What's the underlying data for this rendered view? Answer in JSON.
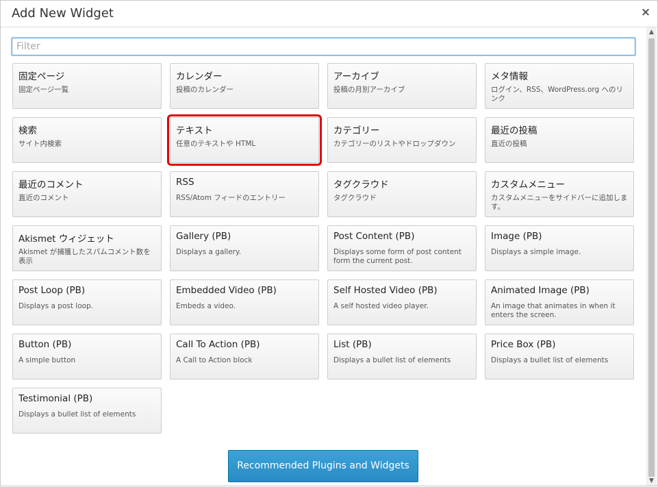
{
  "dialog": {
    "title": "Add New Widget",
    "close_symbol": "×"
  },
  "filter": {
    "placeholder": "Filter",
    "value": ""
  },
  "widgets": [
    {
      "title": "固定ページ",
      "desc": "固定ページ一覧"
    },
    {
      "title": "カレンダー",
      "desc": "投稿のカレンダー"
    },
    {
      "title": "アーカイブ",
      "desc": "投稿の月別アーカイブ"
    },
    {
      "title": "メタ情報",
      "desc": "ログイン、RSS、WordPress.org へのリンク"
    },
    {
      "title": "検索",
      "desc": "サイト内検索"
    },
    {
      "title": "テキスト",
      "desc": "任意のテキストや HTML",
      "highlighted": true
    },
    {
      "title": "カテゴリー",
      "desc": "カテゴリーのリストやドロップダウン"
    },
    {
      "title": "最近の投稿",
      "desc": "直近の投稿"
    },
    {
      "title": "最近のコメント",
      "desc": "直近のコメント"
    },
    {
      "title": "RSS",
      "desc": "RSS/Atom フィードのエントリー"
    },
    {
      "title": "タグクラウド",
      "desc": "タグクラウド"
    },
    {
      "title": "カスタムメニュー",
      "desc": "カスタムメニューをサイドバーに追加します。"
    },
    {
      "title": "Akismet ウィジェット",
      "desc": "Akismet が捕獲したスパムコメント数を表示"
    },
    {
      "title": "Gallery (PB)",
      "desc": "Displays a gallery."
    },
    {
      "title": "Post Content (PB)",
      "desc": "Displays some form of post content form the current post."
    },
    {
      "title": "Image (PB)",
      "desc": "Displays a simple image."
    },
    {
      "title": "Post Loop (PB)",
      "desc": "Displays a post loop."
    },
    {
      "title": "Embedded Video (PB)",
      "desc": "Embeds a video."
    },
    {
      "title": "Self Hosted Video (PB)",
      "desc": "A self hosted video player."
    },
    {
      "title": "Animated Image (PB)",
      "desc": "An image that animates in when it enters the screen."
    },
    {
      "title": "Button (PB)",
      "desc": "A simple button"
    },
    {
      "title": "Call To Action (PB)",
      "desc": "A Call to Action block"
    },
    {
      "title": "List (PB)",
      "desc": "Displays a bullet list of elements"
    },
    {
      "title": "Price Box (PB)",
      "desc": "Displays a bullet list of elements"
    },
    {
      "title": "Testimonial (PB)",
      "desc": "Displays a bullet list of elements"
    }
  ],
  "recommended_button": {
    "label": "Recommended Plugins and Widgets"
  },
  "scrollbar": {
    "up_arrow": "▲",
    "down_arrow": "▼"
  },
  "colors": {
    "highlight": "#e00000",
    "button_bg": "#2a8bc4",
    "filter_border": "#5b9dd9"
  }
}
